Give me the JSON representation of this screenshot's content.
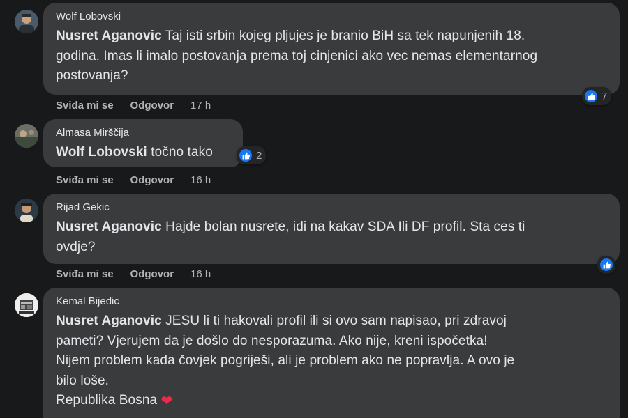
{
  "comments": [
    {
      "author": "Wolf Lobovski",
      "mention": "Nusret Aganovic",
      "lines": [
        "Taj isti srbin kojeg pljujes je branio BiH sa tek napunjenih 18.",
        "godina. Imas li imalo postovanja prema toj cinjenici ako vec nemas elementarnog",
        "postovanja?"
      ],
      "reactions": "7",
      "like_label": "Sviđa mi se",
      "reply_label": "Odgovor",
      "time": "17 h"
    },
    {
      "author": "Almasa Mirščija",
      "mention": "Wolf Lobovski",
      "lines": [
        "točno tako"
      ],
      "reactions": "2",
      "like_label": "Sviđa mi se",
      "reply_label": "Odgovor",
      "time": "16 h"
    },
    {
      "author": "Rijad Gekic",
      "mention": "Nusret Aganovic",
      "lines": [
        "Hajde bolan nusrete, idi na kakav SDA Ili DF profil. Sta ces ti",
        "ovdje?"
      ],
      "reactions": "",
      "like_label": "Sviđa mi se",
      "reply_label": "Odgovor",
      "time": "16 h"
    },
    {
      "author": "Kemal Bijedic",
      "mention": "Nusret Aganovic",
      "lines": [
        "JESU li ti hakovali profil ili si ovo sam napisao, pri zdravoj",
        "pameti? Vjerujem da je došlo do nesporazuma. Ako nije, kreni ispočetka!",
        "Nijem problem kada čovjek pogriješi, ali je problem ako ne popravlja. A ovo je",
        "bilo loše.",
        "Republika Bosna"
      ],
      "heart": "❤",
      "icons": {
        "reaction": "like-icon",
        "emoji": "heart-emoji"
      },
      "colors": {
        "bubble": "#3a3b3c",
        "like": "#1877f2",
        "heart": "#f02849"
      }
    }
  ]
}
